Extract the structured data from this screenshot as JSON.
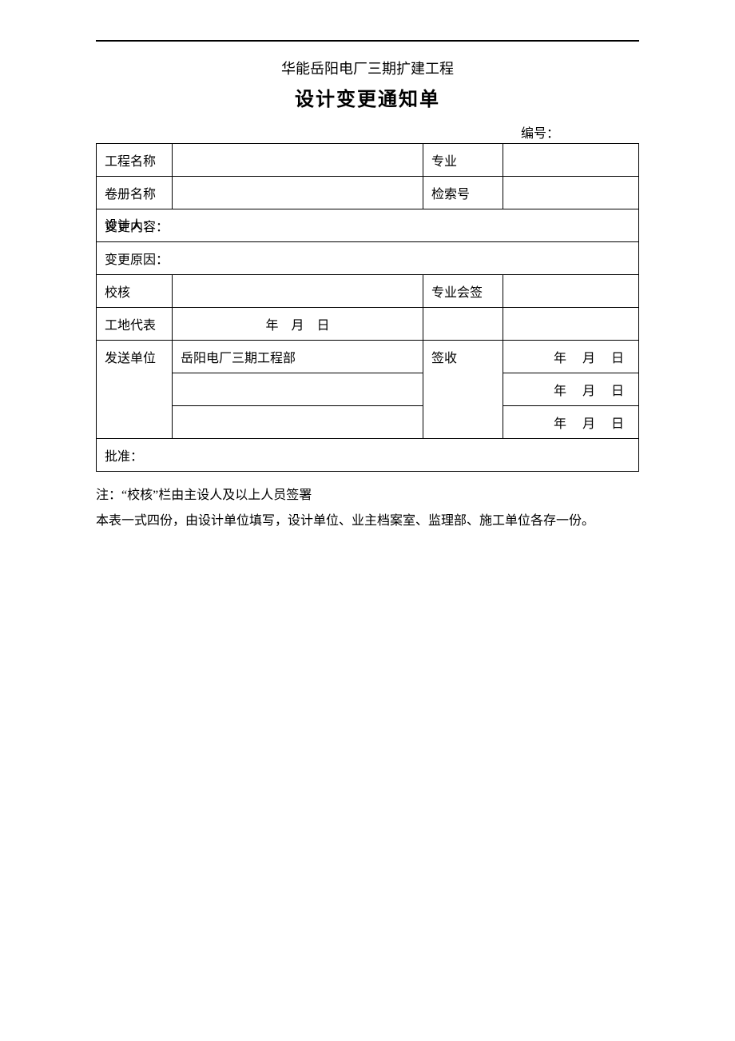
{
  "header": {
    "subtitle": "华能岳阳电厂三期扩建工程",
    "title": "设计变更通知单",
    "number_label": "编号："
  },
  "rows": {
    "project_name_label": "工程名称",
    "project_name_value": "",
    "specialty_label": "专业",
    "specialty_value": "",
    "volume_name_label": "卷册名称",
    "volume_name_value": "",
    "index_no_label": "检索号",
    "index_no_value": "",
    "change_content_label": "变更内容：",
    "designer_label": "设计人：",
    "change_reason_label": "变更原因：",
    "review_label": "校核",
    "cosign_label": "专业会签",
    "site_rep_label": "工地代表",
    "site_rep_date": "年　月　日",
    "send_unit_label": "发送单位",
    "send_unit_value": "岳阳电厂三期工程部",
    "sign_receive_label": "签收",
    "sign_date_1": "年　月　日",
    "sign_date_2": "年　月　日",
    "sign_date_3": "年　月　日",
    "approve_label": "批准："
  },
  "notes": {
    "line1": "注：“校核”栏由主设人及以上人员签署",
    "line2": "本表一式四份，由设计单位填写，设计单位、业主档案室、监理部、施工单位各存一份。"
  }
}
